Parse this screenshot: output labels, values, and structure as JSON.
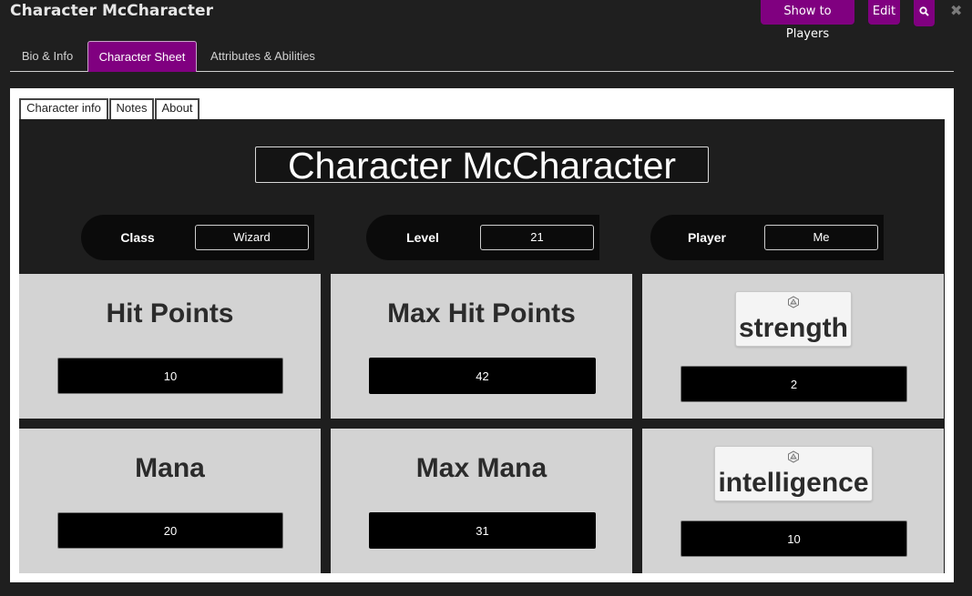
{
  "window": {
    "title": "Character McCharacter"
  },
  "header_buttons": {
    "show_to_players": "Show to Players",
    "edit": "Edit"
  },
  "tabs": [
    {
      "label": "Bio & Info"
    },
    {
      "label": "Character Sheet",
      "active": true
    },
    {
      "label": "Attributes & Abilities"
    }
  ],
  "subtabs": [
    {
      "label": "Character info"
    },
    {
      "label": "Notes"
    },
    {
      "label": "About"
    }
  ],
  "character": {
    "name": "Character McCharacter",
    "fields": [
      {
        "label": "Class",
        "value": "Wizard"
      },
      {
        "label": "Level",
        "value": "21"
      },
      {
        "label": "Player",
        "value": "Me"
      }
    ]
  },
  "stats": {
    "hit_points": {
      "label": "Hit Points",
      "value": "10"
    },
    "max_hit_points": {
      "label": "Max Hit Points",
      "value": "42"
    },
    "strength": {
      "label": "strength",
      "value": "2"
    },
    "mana": {
      "label": "Mana",
      "value": "20"
    },
    "max_mana": {
      "label": "Max Mana",
      "value": "31"
    },
    "intelligence": {
      "label": "intelligence",
      "value": "10"
    }
  },
  "colors": {
    "accent": "#800080",
    "background": "#1f1f1f",
    "stat_cell": "#d3d3d3"
  },
  "icons": {
    "search": "search-icon",
    "close": "close-icon",
    "dice": "d20-icon"
  }
}
